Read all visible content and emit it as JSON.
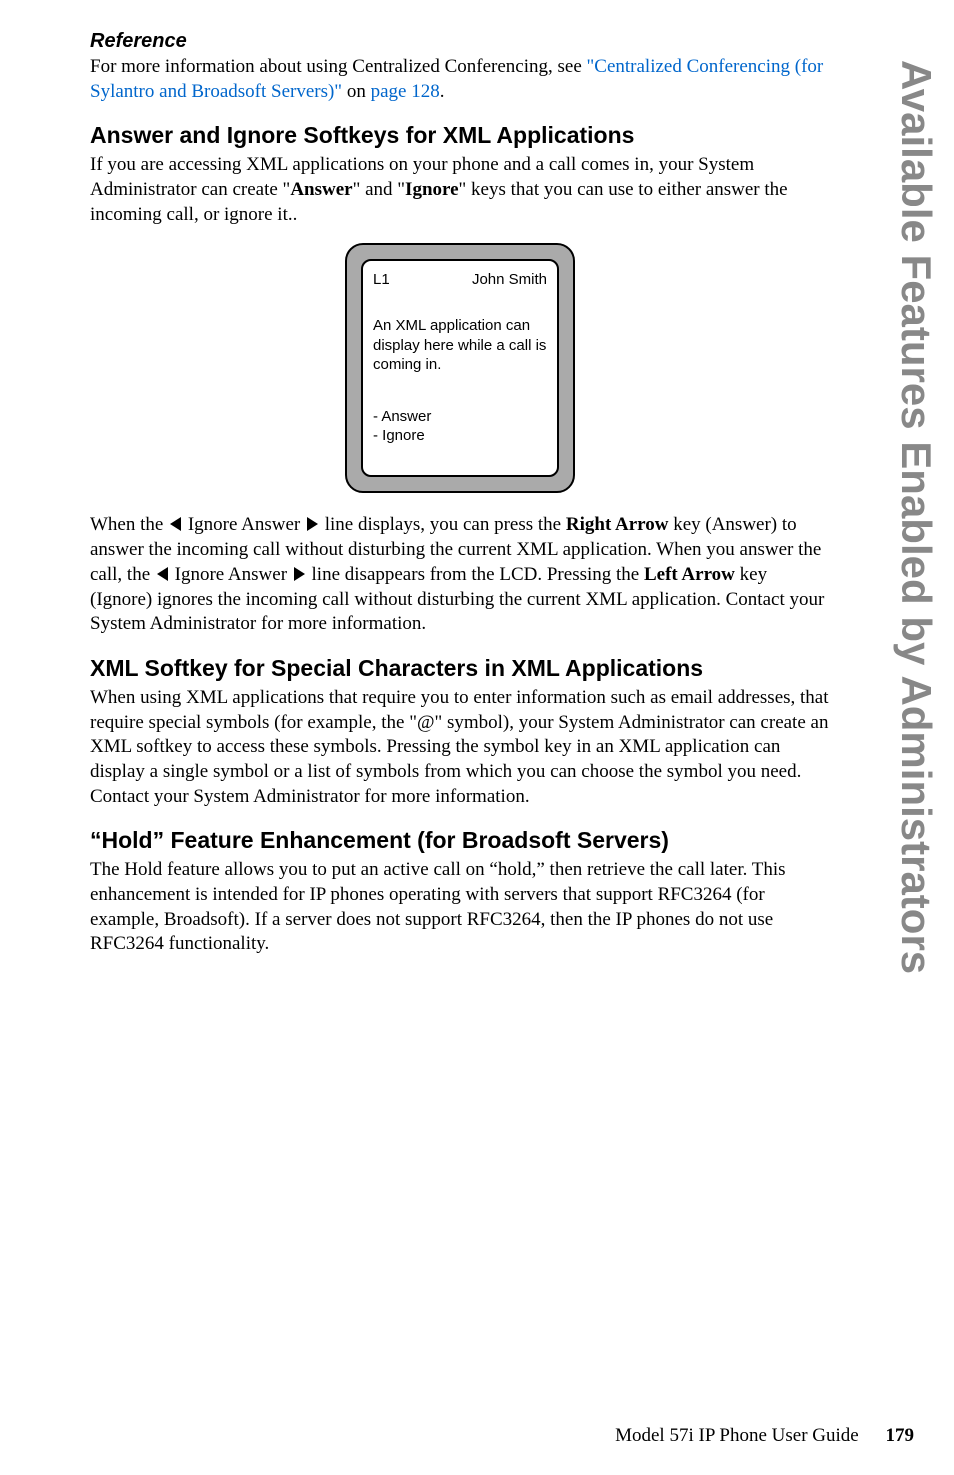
{
  "reference": {
    "heading": "Reference",
    "intro": "For more information about using Centralized Conferencing, see ",
    "link": "\"Centralized Conferencing (for Sylantro and Broadsoft Servers)\"",
    "middle": " on ",
    "pageLink": "page 128",
    "end": "."
  },
  "section1": {
    "heading": "Answer and Ignore Softkeys for XML Applications",
    "p1a": "If you are accessing XML applications on your phone and a call comes in, your System Administrator can create \"",
    "p1b": "Answer",
    "p1c": "\" and \"",
    "p1d": "Ignore",
    "p1e": "\" keys that you can use to either answer the incoming call, or ignore it.."
  },
  "phone": {
    "line": "L1",
    "name": "John Smith",
    "msg": "An XML application can display here while a call is coming in.",
    "opt1": "- Answer",
    "opt2": "- Ignore"
  },
  "para2": {
    "a": "When the ",
    "b": " Ignore Answer ",
    "c": " line displays, you can press the ",
    "d": "Right Arrow",
    "e": " key (Answer) to answer the incoming call without disturbing the current XML application. When you answer the call, the ",
    "f": " Ignore Answer ",
    "g": " line disappears from the LCD. Pressing the ",
    "h": "Left Arrow",
    "i": " key (Ignore) ignores the incoming call without disturbing the current XML application. Contact your System Administrator for more information."
  },
  "section2": {
    "heading": "XML Softkey for Special Characters in XML Applications",
    "p": "When using XML applications that require you to enter information such as email addresses, that require special symbols (for example, the \"@\" symbol), your System Administrator can create an XML softkey to access these symbols. Pressing the symbol key in an XML application can display a single symbol or a list of symbols from which you can choose the symbol you need. Contact your System Administrator for more information."
  },
  "section3": {
    "heading": "“Hold” Feature Enhancement (for Broadsoft Servers)",
    "p": "The Hold feature allows you to put an active call on “hold,” then retrieve the call later. This enhancement is intended for IP phones operating with servers that support RFC3264 (for example, Broadsoft). If a server does not support RFC3264, then the IP phones do not use RFC3264 functionality."
  },
  "sideTab": "Available Features Enabled by Administrators",
  "footer": {
    "text": "Model 57i IP Phone User Guide",
    "page": "179"
  }
}
